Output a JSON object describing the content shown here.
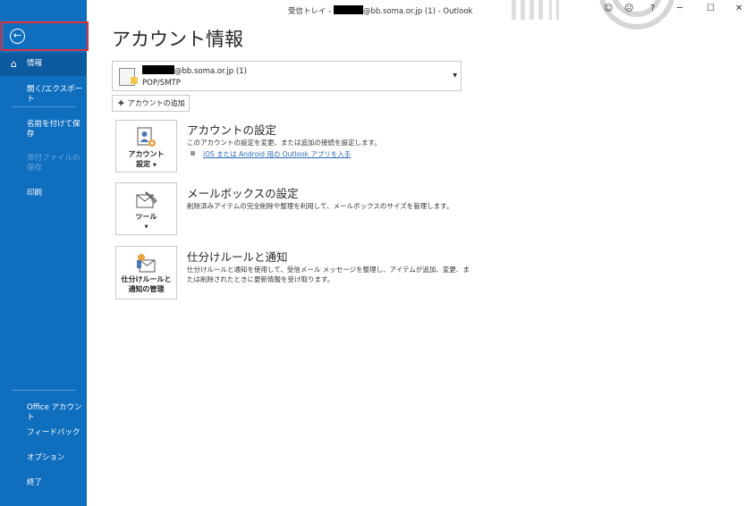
{
  "titlebar": {
    "title_prefix": "受信トレイ - ",
    "title_suffix": "@bb.soma.or.jp (1)  -  Outlook",
    "help_label": "?",
    "minimize_label": "─",
    "restore_label": "☐",
    "close_label": "✕"
  },
  "sidebar": {
    "back_icon": "←",
    "items": [
      {
        "label": "情報",
        "state": "active"
      },
      {
        "label": "開く/エクスポート",
        "state": "normal"
      },
      {
        "label": "名前を付けて保存",
        "state": "normal"
      },
      {
        "label": "添付ファイルの保存",
        "state": "disabled"
      },
      {
        "label": "印刷",
        "state": "normal"
      },
      {
        "label": "Office アカウント",
        "state": "normal"
      },
      {
        "label": "フィードバック",
        "state": "normal"
      },
      {
        "label": "オプション",
        "state": "normal"
      },
      {
        "label": "終了",
        "state": "normal"
      }
    ]
  },
  "main": {
    "title": "アカウント情報",
    "account": {
      "name_suffix": "@bb.soma.or.jp (1)",
      "type": "POP/SMTP",
      "caret": "▼"
    },
    "add_account_label": "アカウントの追加",
    "sections": [
      {
        "tile_label_1": "アカウント",
        "tile_label_2": "設定",
        "title": "アカウントの設定",
        "description": "このアカウントの設定を変更、または追加の接続を設定します。",
        "link": "iOS または Android 用の Outlook アプリを入手"
      },
      {
        "tile_label_1": "ツール",
        "title": "メールボックスの設定",
        "description": "削除済みアイテムの完全削除や整理を利用して、メールボックスのサイズを管理します。"
      },
      {
        "tile_label_1": "仕分けルールと",
        "tile_label_2": "通知の管理",
        "title": "仕分けルールと通知",
        "description_1": "仕分けルールと通知を使用して、受信メール メッセージを整理し、アイテムが追加、変更、ま",
        "description_2": "たは削除されたときに更新情報を受け取ります。"
      }
    ]
  },
  "colors": {
    "sidebar_bg": "#106ebe",
    "sidebar_active": "#0c5aa0",
    "highlight_border": "#e0303c",
    "link": "#2c6cb6"
  }
}
